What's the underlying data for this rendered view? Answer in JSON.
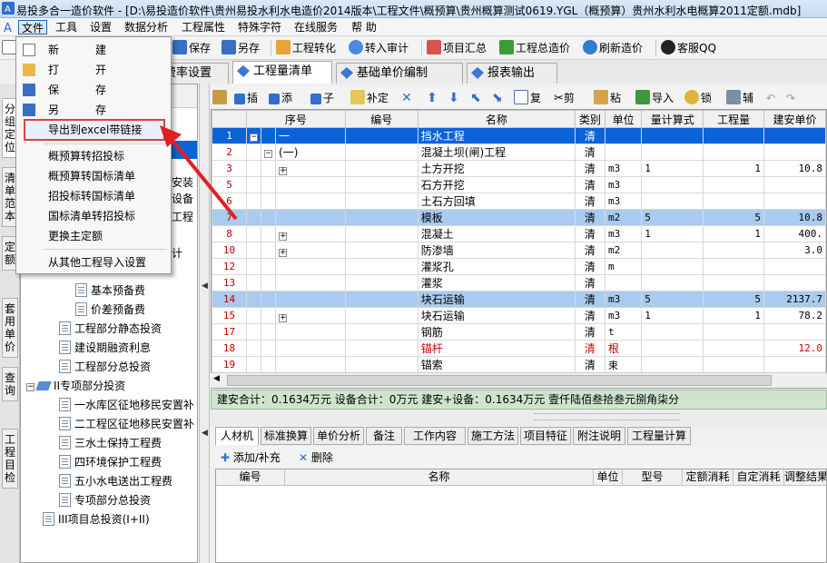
{
  "title": "易投多合一造价软件 - [D:\\易投造价软件\\贵州易投水利水电造价2014版本\\工程文件\\概预算\\贵州概算测试0619.YGL（概预算）贵州水利水电概算2011定额.mdb]",
  "menu": [
    "文件",
    "工具",
    "设置",
    "数据分析",
    "工程属性",
    "特殊字符",
    "在线服务",
    "帮 助"
  ],
  "toolbar": [
    "保存",
    "另存",
    "工程转化",
    "转入审计",
    "项目汇总",
    "工程总造价",
    "刷新造价",
    "客服QQ"
  ],
  "tabs": [
    "费率设置",
    "工程量清单",
    "基础单价编制",
    "报表输出"
  ],
  "vtabs": [
    "分组定位",
    "清单范本",
    "定额",
    "套用单价",
    "查询",
    "工程目检"
  ],
  "dropdown": {
    "top": [
      {
        "a": "新",
        "b": "建"
      },
      {
        "a": "打",
        "b": "开"
      },
      {
        "a": "保",
        "b": "存"
      },
      {
        "a": "另",
        "b": "存"
      }
    ],
    "export": "导出到excel带链接",
    "mid": [
      "概预算转招投标",
      "概预算转国标清单",
      "招投标转国标清单",
      "国标清单转招投标",
      "更换主定额"
    ],
    "bottom": "从其他工程导入设置"
  },
  "tree": {
    "partial": [
      "安装",
      "设备",
      "工程",
      "计"
    ],
    "nodes": [
      {
        "text": "预备费",
        "indent": 1,
        "kind": "folder",
        "clip": true
      },
      {
        "text": "基本预备费",
        "indent": 3,
        "kind": "doc"
      },
      {
        "text": "价差预备费",
        "indent": 3,
        "kind": "doc"
      },
      {
        "text": "工程部分静态投资",
        "indent": 2,
        "kind": "doc"
      },
      {
        "text": "建设期融资利息",
        "indent": 2,
        "kind": "doc"
      },
      {
        "text": "工程部分总投资",
        "indent": 2,
        "kind": "doc"
      },
      {
        "text": "II专项部分投资",
        "indent": 0,
        "kind": "folder"
      },
      {
        "text": "一水库区征地移民安置补",
        "indent": 2,
        "kind": "doc"
      },
      {
        "text": "二工程区征地移民安置补",
        "indent": 2,
        "kind": "doc"
      },
      {
        "text": "三水土保持工程费",
        "indent": 2,
        "kind": "doc"
      },
      {
        "text": "四环境保护工程费",
        "indent": 2,
        "kind": "doc"
      },
      {
        "text": "五小水电送出工程费",
        "indent": 2,
        "kind": "doc"
      },
      {
        "text": "专项部分总投资",
        "indent": 2,
        "kind": "doc"
      },
      {
        "text": "III项目总投资(I+II)",
        "indent": 1,
        "kind": "doc"
      }
    ]
  },
  "gridtoolbar": [
    "插",
    "添",
    "子",
    "补定",
    "复",
    "剪",
    "粘",
    "导入",
    "锁",
    "辅"
  ],
  "grid": {
    "columns": [
      "序号",
      "编号",
      "名称",
      "类别",
      "单位",
      "量计算式",
      "工程量",
      "建安单价"
    ],
    "rows": [
      {
        "ln": "1",
        "seq": "一",
        "code": "",
        "name": "挡水工程",
        "type": "清",
        "unit": "",
        "formula": "",
        "qty": "",
        "price": "",
        "state": "sel",
        "tree": "minus0"
      },
      {
        "ln": "2",
        "seq": "(一)",
        "code": "",
        "name": "混凝土坝(闸)工程",
        "type": "清",
        "unit": "",
        "formula": "",
        "qty": "",
        "price": "",
        "state": "",
        "tree": "minus1"
      },
      {
        "ln": "3",
        "seq": "",
        "code": "",
        "name": "土方开挖",
        "type": "清",
        "unit": "m3",
        "formula": "1",
        "qty": "1",
        "price": "10.8",
        "state": "",
        "tree": "plus"
      },
      {
        "ln": "5",
        "seq": "",
        "code": "",
        "name": "石方开挖",
        "type": "清",
        "unit": "m3",
        "formula": "",
        "qty": "",
        "price": "",
        "state": "",
        "tree": ""
      },
      {
        "ln": "6",
        "seq": "",
        "code": "",
        "name": "土石方回填",
        "type": "清",
        "unit": "m3",
        "formula": "",
        "qty": "",
        "price": "",
        "state": "",
        "tree": ""
      },
      {
        "ln": "7",
        "seq": "",
        "code": "",
        "name": "模板",
        "type": "清",
        "unit": "m2",
        "formula": "5",
        "qty": "5",
        "price": "10.8",
        "state": "hl",
        "tree": ""
      },
      {
        "ln": "8",
        "seq": "",
        "code": "",
        "name": "混凝土",
        "type": "清",
        "unit": "m3",
        "formula": "1",
        "qty": "1",
        "price": "400.",
        "state": "",
        "tree": "plus"
      },
      {
        "ln": "10",
        "seq": "",
        "code": "",
        "name": "防渗墙",
        "type": "清",
        "unit": "m2",
        "formula": "",
        "qty": "",
        "price": "3.0",
        "state": "",
        "tree": "plus"
      },
      {
        "ln": "12",
        "seq": "",
        "code": "",
        "name": "灌浆孔",
        "type": "清",
        "unit": "m",
        "formula": "",
        "qty": "",
        "price": "",
        "state": "",
        "tree": ""
      },
      {
        "ln": "13",
        "seq": "",
        "code": "",
        "name": "灌浆",
        "type": "清",
        "unit": "",
        "formula": "",
        "qty": "",
        "price": "",
        "state": "",
        "tree": ""
      },
      {
        "ln": "14",
        "seq": "",
        "code": "",
        "name": "块石运输",
        "type": "清",
        "unit": "m3",
        "formula": "5",
        "qty": "5",
        "price": "2137.7",
        "state": "hl",
        "tree": ""
      },
      {
        "ln": "15",
        "seq": "",
        "code": "",
        "name": "块石运输",
        "type": "清",
        "unit": "m3",
        "formula": "1",
        "qty": "1",
        "price": "78.2",
        "state": "",
        "tree": "plus"
      },
      {
        "ln": "17",
        "seq": "",
        "code": "",
        "name": "钢筋",
        "type": "清",
        "unit": "t",
        "formula": "",
        "qty": "",
        "price": "",
        "state": "",
        "tree": ""
      },
      {
        "ln": "18",
        "seq": "",
        "code": "",
        "name": "锚杆",
        "type": "清",
        "unit": "根",
        "formula": "",
        "qty": "",
        "price": "12.0",
        "state": "red",
        "tree": ""
      },
      {
        "ln": "19",
        "seq": "",
        "code": "",
        "name": "锚索",
        "type": "清",
        "unit": "束",
        "formula": "",
        "qty": "",
        "price": "",
        "state": "",
        "tree": ""
      }
    ]
  },
  "summary": "建安合计：0.1634万元  设备合计：0万元  建安+设备：0.1634万元  壹仟陆佰叁拾叁元捌角柒分",
  "bottomtabs": [
    "人材机",
    "标准换算",
    "单价分析",
    "备注",
    "工作内容",
    "施工方法",
    "项目特征",
    "附注说明",
    "工程量计算"
  ],
  "bottomtoolbar": [
    "添加/补充",
    "删除"
  ],
  "bottomcols": [
    "编号",
    "名称",
    "单位",
    "型号",
    "定额消耗",
    "自定消耗",
    "调整结果"
  ],
  "colors": {
    "selection": "#0b63d8",
    "highlight": "#a9cbef",
    "summary_bg": "#cfe3cf",
    "export_box": "#e04040",
    "arrow": "#e02020"
  }
}
